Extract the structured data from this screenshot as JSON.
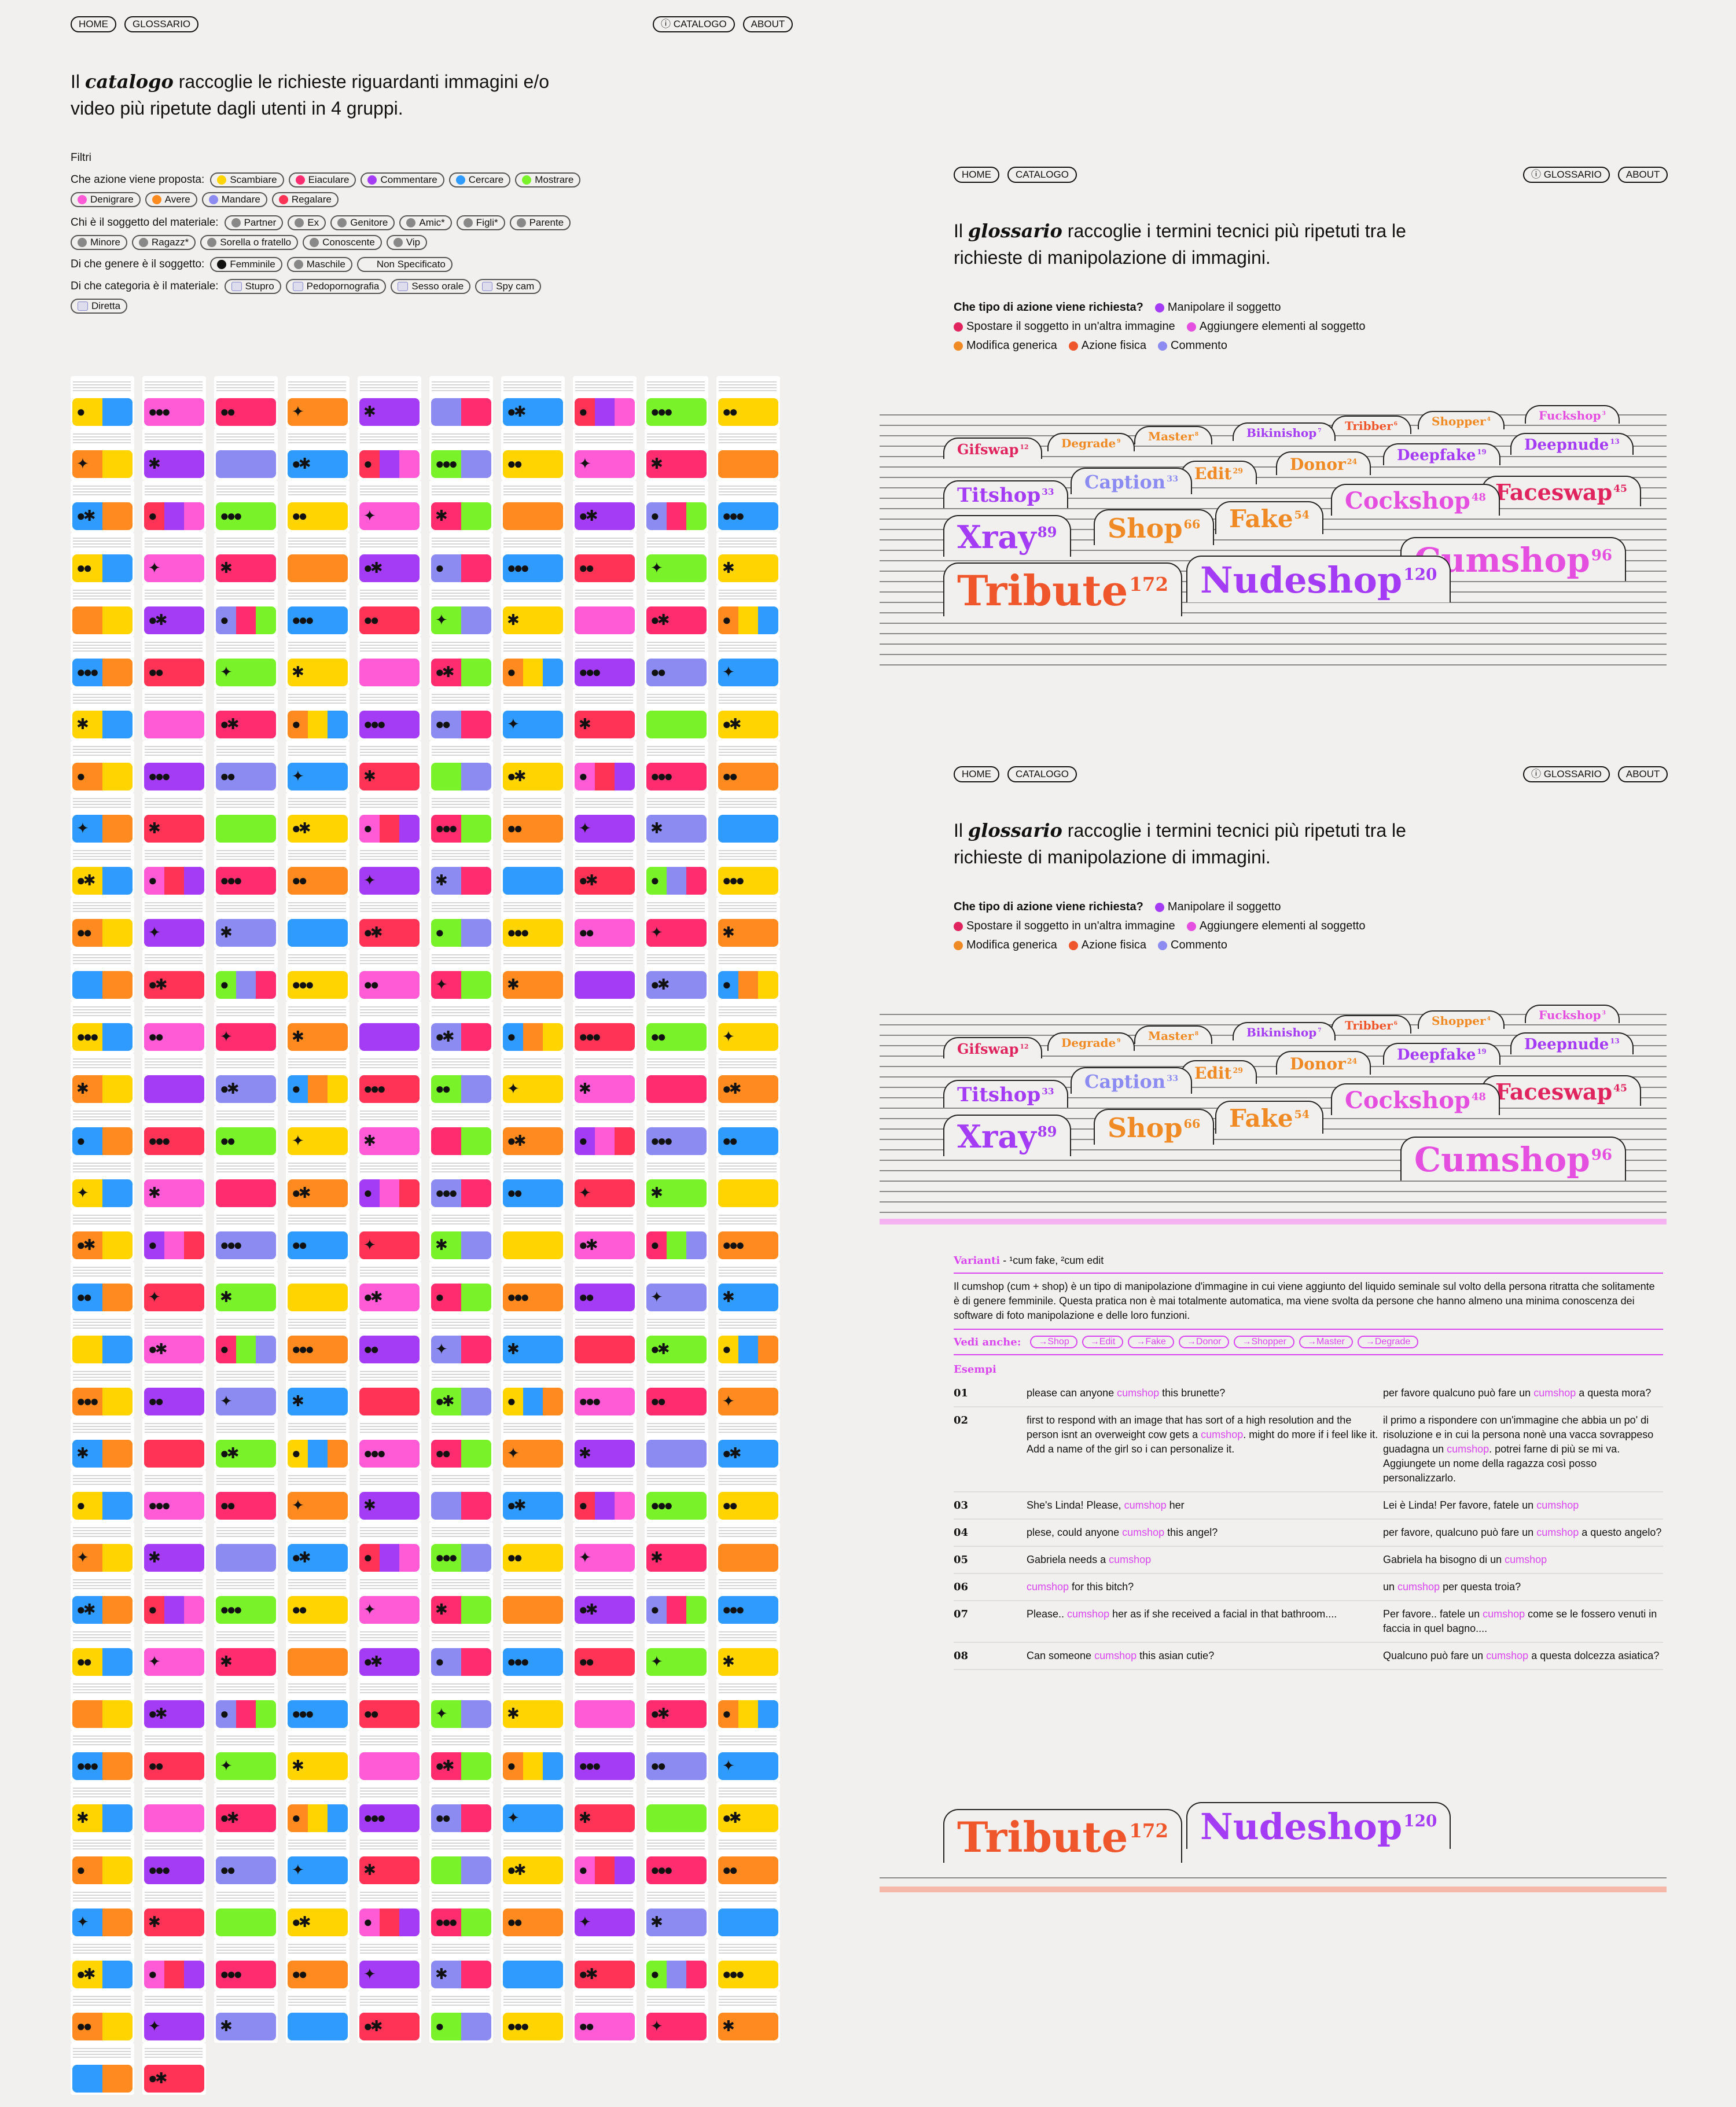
{
  "catalog": {
    "nav": {
      "home": "HOME",
      "glossario": "GLOSSARIO",
      "catalogo": "ⓘ CATALOGO",
      "about": "ABOUT"
    },
    "intro_before": "Il ",
    "intro_em": "catalogo",
    "intro_after": " raccoglie le richieste riguardanti immagini e/o video più ripetute dagli utenti in 4 gruppi.",
    "filters_title": "Filtri",
    "azione_label": "Che azione viene proposta:",
    "azioni": [
      {
        "label": "Scambiare",
        "color": "#ffd400"
      },
      {
        "label": "Eiaculare",
        "color": "#ff2d6f"
      },
      {
        "label": "Commentare",
        "color": "#a43bf5"
      },
      {
        "label": "Cercare",
        "color": "#2f9bff"
      },
      {
        "label": "Mostrare",
        "color": "#7af22a"
      },
      {
        "label": "Denigrare",
        "color": "#ff5bd6"
      },
      {
        "label": "Avere",
        "color": "#ff8a1f"
      },
      {
        "label": "Mandare",
        "color": "#8b8bf2"
      },
      {
        "label": "Regalare",
        "color": "#ff3355"
      }
    ],
    "soggetto_label": "Chi è il soggetto del materiale:",
    "soggetti": [
      "Partner",
      "Ex",
      "Genitore",
      "Amic*",
      "Figli*",
      "Parente",
      "Minore",
      "Ragazz*",
      "Sorella o fratello",
      "Conoscente",
      "Vip"
    ],
    "genere_label": "Di che genere è il soggetto:",
    "generi": [
      "Femminile",
      "Maschile",
      "Non Specificato"
    ],
    "categoria_label": "Di che categoria è il materiale:",
    "categorie": [
      "Stupro",
      "Pedopornografia",
      "Sesso orale",
      "Spy cam",
      "Diretta"
    ]
  },
  "glossary_top": {
    "nav": {
      "home": "HOME",
      "catalogo": "CATALOGO",
      "glossario": "ⓘ GLOSSARIO",
      "about": "ABOUT"
    },
    "intro_before": "Il ",
    "intro_em": "glossario",
    "intro_after": " raccoglie i termini tecnici più ripetuti tra le richieste di manipolazione di immagini.",
    "legend_label": "Che tipo di azione viene richiesta?",
    "legend": [
      {
        "label": "Manipolare il soggetto",
        "color": "#a43bf5"
      },
      {
        "label": "Spostare il soggetto in un'altra immagine",
        "color": "#e0245e"
      },
      {
        "label": "Aggiungere elementi al soggetto",
        "color": "#e54fe0"
      },
      {
        "label": "Modifica generica",
        "color": "#f08a24"
      },
      {
        "label": "Azione fisica",
        "color": "#f0562c"
      },
      {
        "label": "Commento",
        "color": "#8b8bf2"
      }
    ]
  },
  "tags": [
    {
      "name": "Fuckshop",
      "count": "3",
      "color": "#e54fe0"
    },
    {
      "name": "Shopper",
      "count": "4",
      "color": "#f08a24"
    },
    {
      "name": "Tribber",
      "count": "6",
      "color": "#f0562c"
    },
    {
      "name": "Bikinishop",
      "count": "7",
      "color": "#a43bf5"
    },
    {
      "name": "Master",
      "count": "8",
      "color": "#f08a24"
    },
    {
      "name": "Degrade",
      "count": "9",
      "color": "#f08a24"
    },
    {
      "name": "Gifswap",
      "count": "12",
      "color": "#e0245e"
    },
    {
      "name": "Deepnude",
      "count": "13",
      "color": "#a43bf5"
    },
    {
      "name": "Deepfake",
      "count": "19",
      "color": "#a43bf5"
    },
    {
      "name": "Donor",
      "count": "24",
      "color": "#f08a24"
    },
    {
      "name": "Edit",
      "count": "29",
      "color": "#f08a24"
    },
    {
      "name": "Caption",
      "count": "33",
      "color": "#8b8bf2"
    },
    {
      "name": "Titshop",
      "count": "33",
      "color": "#a43bf5"
    },
    {
      "name": "Faceswap",
      "count": "45",
      "color": "#e0245e"
    },
    {
      "name": "Cockshop",
      "count": "48",
      "color": "#e54fe0"
    },
    {
      "name": "Fake",
      "count": "54",
      "color": "#f08a24"
    },
    {
      "name": "Shop",
      "count": "66",
      "color": "#f08a24"
    },
    {
      "name": "Xray",
      "count": "89",
      "color": "#a43bf5"
    },
    {
      "name": "Cumshop",
      "count": "96",
      "color": "#e54fe0"
    },
    {
      "name": "Nudeshop",
      "count": "120",
      "color": "#a43bf5"
    },
    {
      "name": "Tribute",
      "count": "172",
      "color": "#f0562c"
    }
  ],
  "glossary_detail": {
    "varianti_label": "Varianti",
    "varianti_text": " - ¹cum fake, ²cum edit",
    "definition": "Il cumshop (cum + shop) è un tipo di manipolazione d'immagine in cui viene aggiunto del liquido seminale sul volto della persona ritratta che solitamente è di genere femminile. Questa pratica non è mai totalmente automatica, ma viene svolta da persone che hanno almeno una minima conoscenza dei software di foto manipolazione e delle loro funzioni.",
    "vedi_label": "Vedi anche:",
    "vedi": [
      "→Shop",
      "→Edit",
      "→Fake",
      "→Donor",
      "→Shopper",
      "→Master",
      "→Degrade"
    ],
    "esempi_label": "Esempi",
    "examples": [
      {
        "n": "01",
        "en_a": "please can anyone ",
        "en_hl": "cumshop",
        "en_b": " this brunette?",
        "it_a": "per favore qualcuno può fare un ",
        "it_hl": "cumshop",
        "it_b": " a questa mora?"
      },
      {
        "n": "02",
        "en_a": "first to respond with an image that has sort of a high resolution and the person isnt an overweight cow gets a ",
        "en_hl": "cumshop",
        "en_b": ". might do more if i feel like it. Add a name of the girl so i can personalize it.",
        "it_a": "il primo a rispondere con un'immagine che abbia un po' di risoluzione e in cui la persona nonè una vacca sovrappeso guadagna un ",
        "it_hl": "cumshop",
        "it_b": ". potrei farne di più se mi va. Aggiungete un nome della ragazza così posso personalizzarlo."
      },
      {
        "n": "03",
        "en_a": "She's Linda! Please, ",
        "en_hl": "cumshop",
        "en_b": " her",
        "it_a": "Lei è Linda! Per favore, fatele un ",
        "it_hl": "cumshop",
        "it_b": ""
      },
      {
        "n": "04",
        "en_a": "plese, could anyone ",
        "en_hl": "cumshop",
        "en_b": " this angel?",
        "it_a": "per favore, qualcuno può fare un ",
        "it_hl": "cumshop",
        "it_b": " a questo angelo?"
      },
      {
        "n": "05",
        "en_a": "Gabriela needs a ",
        "en_hl": "cumshop",
        "en_b": "",
        "it_a": "Gabriela ha bisogno di un ",
        "it_hl": "cumshop",
        "it_b": ""
      },
      {
        "n": "06",
        "en_a": "",
        "en_hl": "cumshop",
        "en_b": " for this bitch?",
        "it_a": "un ",
        "it_hl": "cumshop",
        "it_b": " per questa troia?"
      },
      {
        "n": "07",
        "en_a": "Please.. ",
        "en_hl": "cumshop",
        "en_b": " her as if she received a facial in that bathroom....",
        "it_a": "Per favore.. fatele un ",
        "it_hl": "cumshop",
        "it_b": " come se le fossero venuti in faccia in quel bagno...."
      },
      {
        "n": "08",
        "en_a": "Can someone ",
        "en_hl": "cumshop",
        "en_b": " this asian cutie?",
        "it_a": "Qualcuno può fare un ",
        "it_hl": "cumshop",
        "it_b": " a questa dolcezza asiatica?"
      }
    ]
  }
}
